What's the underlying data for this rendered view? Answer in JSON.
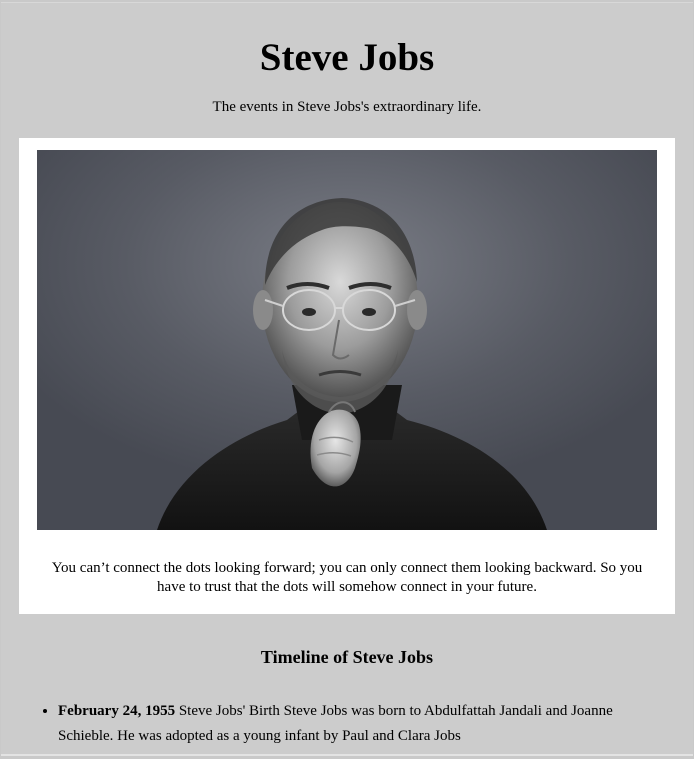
{
  "page": {
    "title": "Steve Jobs",
    "subtitle": "The events in Steve Jobs's extraordinary life."
  },
  "image": {
    "alt": "Steve Jobs",
    "quote": "You can’t connect the dots looking forward; you can only connect them looking backward. So you have to trust that the dots will somehow connect in your future."
  },
  "timeline": {
    "title": "Timeline of Steve Jobs",
    "items": [
      {
        "date": "February 24, 1955",
        "text": "Steve Jobs' Birth Steve Jobs was born to Abdulfattah Jandali and Joanne Schieble. He was adopted as a young infant by Paul and Clara Jobs"
      }
    ]
  },
  "colors": {
    "page_background": "#cccccc",
    "card_background": "#ffffff",
    "photo_background": "#52555e"
  }
}
